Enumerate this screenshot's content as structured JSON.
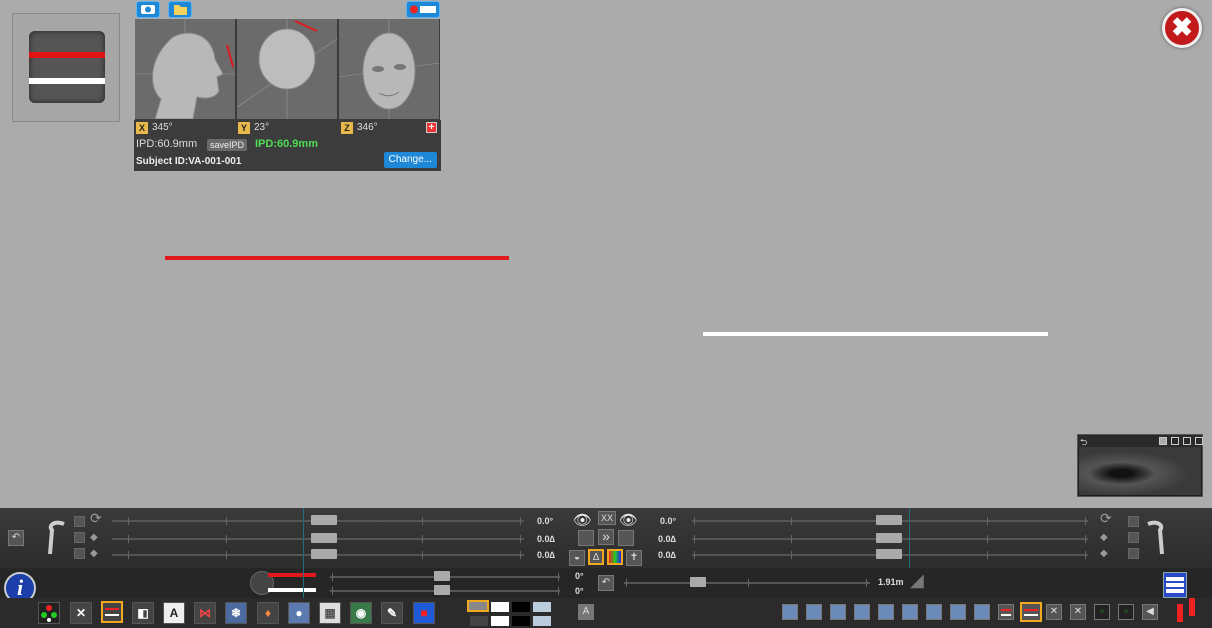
{
  "head_panel": {
    "x_axis": "X",
    "x_value": "345°",
    "y_axis": "Y",
    "y_value": "23°",
    "z_axis": "Z",
    "z_value": "346°",
    "ipd_label": "IPD:60.9mm",
    "save_ipd": "saveIPD",
    "ipd_live": "IPD:60.9mm",
    "subject": "Subject ID:VA-001-001",
    "change": "Change...",
    "reset_icon": "+"
  },
  "close_icon": "✖",
  "controls": {
    "left_values": [
      "0.0°",
      "0.0∆",
      "0.0∆"
    ],
    "right_values": [
      "0.0°",
      "0.0∆",
      "0.0∆"
    ],
    "center_x": "XX",
    "center_arrows": "»",
    "center_delta": "∆",
    "rotation_values": [
      "0°",
      "0°"
    ],
    "distance": "1.91m",
    "info": "i",
    "text_tool": "A",
    "text_tool2": "A"
  },
  "colors": {
    "stimulus_red": "#e0191c",
    "stimulus_white": "#ffffff",
    "accent_blue": "#1e87d8",
    "selection_orange": "#f0a91e",
    "ipd_green": "#4fdc55"
  }
}
